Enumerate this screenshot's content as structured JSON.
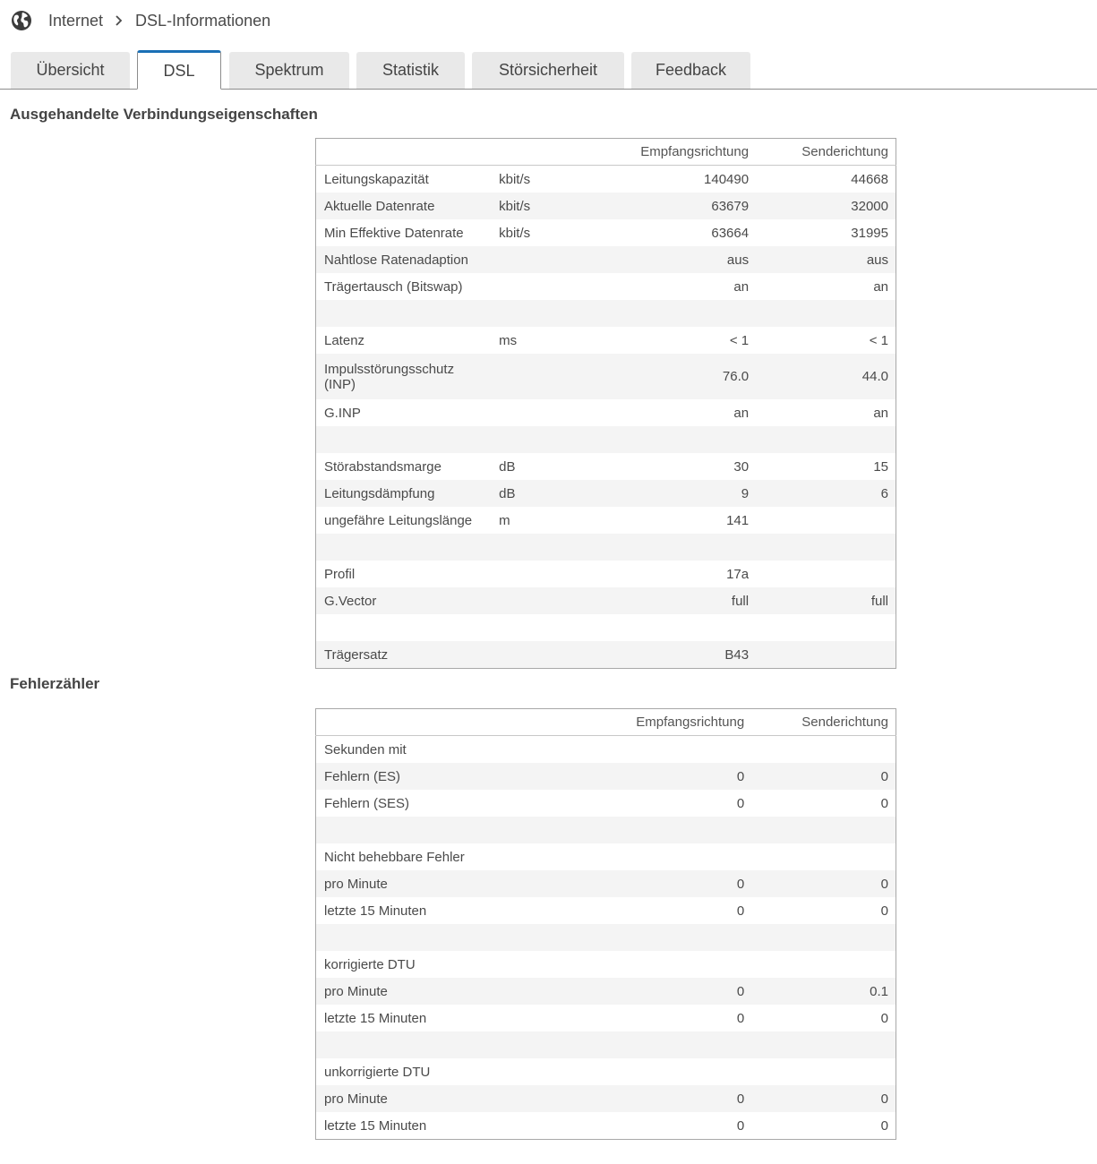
{
  "breadcrumb": {
    "icon": "globe-icon",
    "items": [
      "Internet",
      "DSL-Informationen"
    ]
  },
  "tabs": [
    {
      "label": "Übersicht",
      "active": false
    },
    {
      "label": "DSL",
      "active": true
    },
    {
      "label": "Spektrum",
      "active": false
    },
    {
      "label": "Statistik",
      "active": false
    },
    {
      "label": "Störsicherheit",
      "active": false
    },
    {
      "label": "Feedback",
      "active": false
    }
  ],
  "colors": {
    "accent": "#1a6fb5",
    "tab_bg": "#e9e9e9",
    "row_alt": "#f4f4f4"
  },
  "connection": {
    "title": "Ausgehandelte Verbindungseigenschaften",
    "columns": [
      "Empfangsrichtung",
      "Senderichtung"
    ],
    "rows": [
      {
        "label": "Leitungskapazität",
        "unit": "kbit/s",
        "rx": "140490",
        "tx": "44668"
      },
      {
        "label": "Aktuelle Datenrate",
        "unit": "kbit/s",
        "rx": "63679",
        "tx": "32000"
      },
      {
        "label": "Min Effektive Datenrate",
        "unit": "kbit/s",
        "rx": "63664",
        "tx": "31995"
      },
      {
        "label": "Nahtlose Ratenadaption",
        "unit": "",
        "rx": "aus",
        "tx": "aus"
      },
      {
        "label": "Trägertausch (Bitswap)",
        "unit": "",
        "rx": "an",
        "tx": "an"
      },
      {
        "label": "",
        "unit": "",
        "rx": "",
        "tx": ""
      },
      {
        "label": "Latenz",
        "unit": "ms",
        "rx": "< 1",
        "tx": "< 1"
      },
      {
        "label": "Impulsstörungsschutz (INP)",
        "unit": "",
        "rx": "76.0",
        "tx": "44.0"
      },
      {
        "label": "G.INP",
        "unit": "",
        "rx": "an",
        "tx": "an"
      },
      {
        "label": "",
        "unit": "",
        "rx": "",
        "tx": ""
      },
      {
        "label": "Störabstandsmarge",
        "unit": "dB",
        "rx": "30",
        "tx": "15"
      },
      {
        "label": "Leitungsdämpfung",
        "unit": "dB",
        "rx": "9",
        "tx": "6"
      },
      {
        "label": "ungefähre Leitungslänge",
        "unit": "m",
        "rx": "141",
        "tx": ""
      },
      {
        "label": "",
        "unit": "",
        "rx": "",
        "tx": ""
      },
      {
        "label": "Profil",
        "unit": "",
        "rx": "17a",
        "tx": ""
      },
      {
        "label": "G.Vector",
        "unit": "",
        "rx": "full",
        "tx": "full"
      },
      {
        "label": "",
        "unit": "",
        "rx": "",
        "tx": ""
      },
      {
        "label": "Trägersatz",
        "unit": "",
        "rx": "B43",
        "tx": ""
      }
    ]
  },
  "errors": {
    "title": "Fehlerzähler",
    "columns": [
      "Empfangsrichtung",
      "Senderichtung"
    ],
    "rows": [
      {
        "label": "Sekunden mit",
        "rx": "",
        "tx": ""
      },
      {
        "label": "Fehlern (ES)",
        "rx": "0",
        "tx": "0"
      },
      {
        "label": "Fehlern (SES)",
        "rx": "0",
        "tx": "0"
      },
      {
        "label": "",
        "rx": "",
        "tx": ""
      },
      {
        "label": "Nicht behebbare Fehler",
        "rx": "",
        "tx": ""
      },
      {
        "label": "pro Minute",
        "rx": "0",
        "tx": "0"
      },
      {
        "label": "letzte 15 Minuten",
        "rx": "0",
        "tx": "0"
      },
      {
        "label": "",
        "rx": "",
        "tx": ""
      },
      {
        "label": "korrigierte DTU",
        "rx": "",
        "tx": ""
      },
      {
        "label": "pro Minute",
        "rx": "0",
        "tx": "0.1"
      },
      {
        "label": "letzte 15 Minuten",
        "rx": "0",
        "tx": "0"
      },
      {
        "label": "",
        "rx": "",
        "tx": ""
      },
      {
        "label": "unkorrigierte DTU",
        "rx": "",
        "tx": ""
      },
      {
        "label": "pro Minute",
        "rx": "0",
        "tx": "0"
      },
      {
        "label": "letzte 15 Minuten",
        "rx": "0",
        "tx": "0"
      }
    ]
  }
}
